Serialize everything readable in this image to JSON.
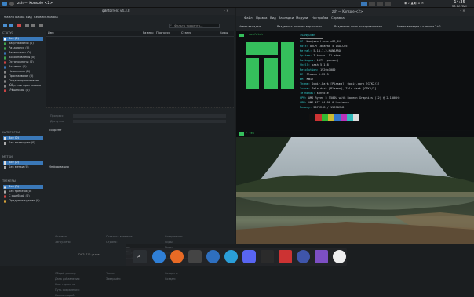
{
  "topbar": {
    "title": "zsh — Konsole <2>",
    "time": "14:35",
    "date": "08.10.2021"
  },
  "qbit": {
    "title": "qBittorrent v4.3.8",
    "menu": [
      "Файл",
      "Правка",
      "Вид",
      "Сервис",
      "Справка"
    ],
    "search_placeholder": "Фильтр торрента...",
    "cols": [
      "Имя",
      "Размер",
      "Прогресс",
      "Статус",
      "Сиды"
    ],
    "status_h": "СТАТУС",
    "status": [
      "Все (0)",
      "Загружаются (0)",
      "Раздаются (0)",
      "Завершены (0)",
      "Возобновлены (0)",
      "Остановлены (0)",
      "Активны (0)",
      "Неактивны (0)",
      "Простаивают (0)",
      "Отдача простаивает (0)",
      "Загрузки простаивают (0)",
      "С ошибкой (0)"
    ],
    "cat_h": "КАТЕГОРИИ",
    "cats": [
      "Все (0)",
      "Без категории (0)"
    ],
    "tag_h": "МЕТКИ",
    "tags": [
      "Все (0)",
      "Без метки (0)"
    ],
    "trk_h": "ТРЕКЕРЫ",
    "trackers": [
      "Все (0)",
      "Без трекера (0)",
      "С ошибкой (0)",
      "Предупреждения (0)"
    ],
    "progress": "Прогресс:",
    "avail": "Доступно:",
    "transfer_h": "Торрент",
    "info_h": "Информация",
    "transfer": [
      [
        "Активен:",
        "Осталось времени:",
        "Соединения:"
      ],
      [
        "Загружено:",
        "Отдано:",
        "Сиды:"
      ],
      [
        "Скорость загрузки:",
        "Скорость отдачи:",
        "Пиры:"
      ],
      [
        "Ограничение загрузки:",
        "Ограничение отдачи:",
        "Потеряно:"
      ],
      [
        "Повторно получено:",
        "Последний полный:",
        "Лимит соединений:"
      ]
    ],
    "info": [
      [
        "Общий размер:",
        "Части:",
        "Создан в:"
      ],
      [
        "Дата добавления:",
        "Завершён:",
        "Создан:"
      ],
      [
        "Хеш торрента:",
        "",
        " "
      ],
      [
        "Путь сохранения:",
        "",
        ""
      ],
      [
        "Комментарий:",
        "",
        ""
      ]
    ],
    "tabs": [
      "Главное",
      "Трекеры",
      "Пиры",
      "Веб-сиды",
      "Файлы"
    ],
    "statusbar": "DHT: 712 узлов"
  },
  "konsole": {
    "title": "zsh — Konsole <2>",
    "menu": [
      "Файл",
      "Правка",
      "Вид",
      "Закладки",
      "Модули",
      "Настройка",
      "Справка"
    ],
    "tabs": [
      "Новая вкладка",
      "Разделить окно по вертикали",
      "Разделить окно по горизонтали",
      "Новая вкладка с ключом 2+2"
    ],
    "prompt1": "~ neofetch",
    "user": "ivan@ivan",
    "info": [
      [
        "OS:",
        "Manjaro Linux x86_64"
      ],
      [
        "Host:",
        "82LM IdeaPad 5 14ALC05"
      ],
      [
        "Kernel:",
        "5.14.7-2-MANJARO"
      ],
      [
        "Uptime:",
        "3 hours, 51 mins"
      ],
      [
        "Packages:",
        "1375 (pacman)"
      ],
      [
        "Shell:",
        "bash 5.1.8"
      ],
      [
        "Resolution:",
        "1920x1080"
      ],
      [
        "DE:",
        "Plasma 5.22.5"
      ],
      [
        "WM:",
        "KWin"
      ],
      [
        "Theme:",
        "Qogir-Dark [Plasma], Qogir-dark [GTK2/3]"
      ],
      [
        "Icons:",
        "Tela-dark [Plasma], Tela-dark [GTK2/3]"
      ],
      [
        "Terminal:",
        "konsole"
      ],
      [
        "CPU:",
        "AMD Ryzen 5 5500U with Radeon Graphics (12) @ 2.100GHz"
      ],
      [
        "GPU:",
        "AMD ATI 04:00.0 Lucienne"
      ],
      [
        "Memory:",
        "2079MiB / 15650MiB"
      ]
    ],
    "prompt2": "~ feh"
  },
  "colors": {
    "accent": "#3a78b8",
    "manjaro": "#35bf5c",
    "teal": "#33cccc"
  }
}
